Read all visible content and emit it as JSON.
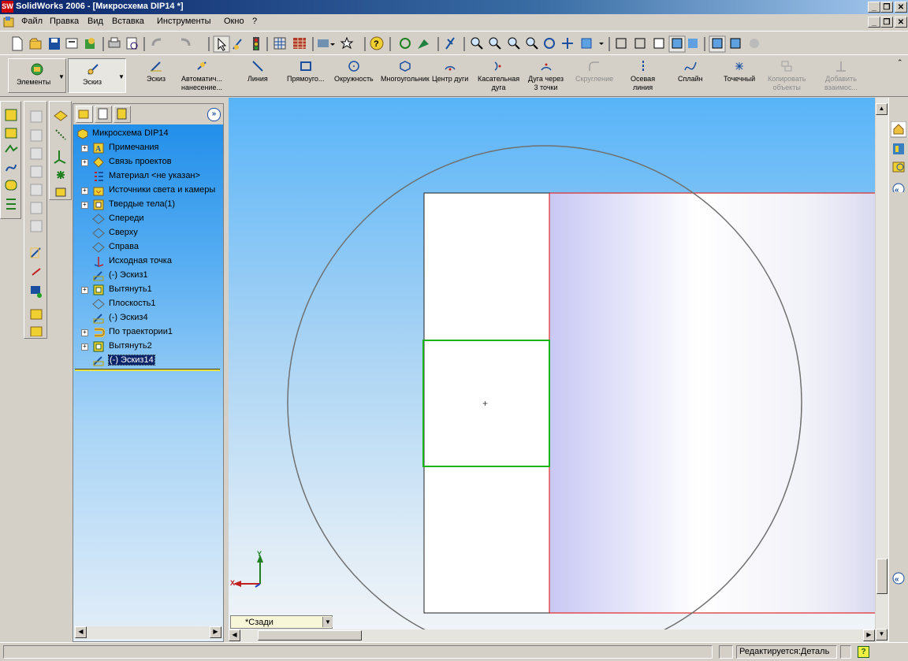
{
  "window": {
    "title": "SolidWorks 2006 - [Микросхема DIP14 *]",
    "app_icon": "SW",
    "min": "_",
    "restore": "❐",
    "close": "✕"
  },
  "menu": {
    "items": [
      "Файл",
      "Правка",
      "Вид",
      "Вставка",
      "Инструменты",
      "Окно",
      "?"
    ]
  },
  "command_manager": {
    "features_label": "Элементы",
    "sketch_tab_label": "Эскиз",
    "commands": [
      {
        "label_1": "Эскиз",
        "label_2": "",
        "icon": "sketch-icon",
        "enabled": true
      },
      {
        "label_1": "Автоматич...",
        "label_2": "нанесение...",
        "icon": "smart-dimension-icon",
        "enabled": true
      },
      {
        "label_1": "Линия",
        "label_2": "",
        "icon": "line-icon",
        "enabled": true
      },
      {
        "label_1": "Прямоуго...",
        "label_2": "",
        "icon": "rectangle-icon",
        "enabled": true
      },
      {
        "label_1": "Окружность",
        "label_2": "",
        "icon": "circle-icon",
        "enabled": true
      },
      {
        "label_1": "Многоугольник",
        "label_2": "",
        "icon": "polygon-icon",
        "enabled": true
      },
      {
        "label_1": "Центр дуги",
        "label_2": "",
        "icon": "centerpoint-arc-icon",
        "enabled": true
      },
      {
        "label_1": "Касательная",
        "label_2": "дуга",
        "icon": "tangent-arc-icon",
        "enabled": true
      },
      {
        "label_1": "Дуга через",
        "label_2": "3 точки",
        "icon": "3point-arc-icon",
        "enabled": true
      },
      {
        "label_1": "Скругление",
        "label_2": "",
        "icon": "fillet-icon",
        "enabled": false
      },
      {
        "label_1": "Осевая",
        "label_2": "линия",
        "icon": "centerline-icon",
        "enabled": true
      },
      {
        "label_1": "Сплайн",
        "label_2": "",
        "icon": "spline-icon",
        "enabled": true
      },
      {
        "label_1": "Точечный",
        "label_2": "",
        "icon": "point-icon",
        "enabled": true
      },
      {
        "label_1": "Копировать",
        "label_2": "объекты",
        "icon": "copy-entities-icon",
        "enabled": false
      },
      {
        "label_1": "Добавить",
        "label_2": "взаимос...",
        "icon": "add-relation-icon",
        "enabled": false
      }
    ]
  },
  "feature_tree": {
    "collapse_glyph": "»",
    "root": "Микросхема DIP14",
    "items": [
      {
        "label": "Примечания",
        "expandable": true,
        "icon": "annotations-icon"
      },
      {
        "label": "Связь проектов",
        "expandable": true,
        "icon": "design-binder-icon"
      },
      {
        "label": "Материал <не указан>",
        "expandable": false,
        "icon": "material-icon"
      },
      {
        "label": "Источники света и камеры",
        "expandable": true,
        "icon": "lights-icon"
      },
      {
        "label": "Твердые тела(1)",
        "expandable": true,
        "icon": "solid-bodies-icon"
      },
      {
        "label": "Спереди",
        "expandable": false,
        "icon": "plane-icon"
      },
      {
        "label": "Сверху",
        "expandable": false,
        "icon": "plane-icon"
      },
      {
        "label": "Справа",
        "expandable": false,
        "icon": "plane-icon"
      },
      {
        "label": "Исходная точка",
        "expandable": false,
        "icon": "origin-icon"
      },
      {
        "label": "(-) Эскиз1",
        "expandable": false,
        "icon": "sketch-icon"
      },
      {
        "label": "Вытянуть1",
        "expandable": true,
        "icon": "extrude-icon"
      },
      {
        "label": "Плоскость1",
        "expandable": false,
        "icon": "plane-icon"
      },
      {
        "label": "(-) Эскиз4",
        "expandable": false,
        "icon": "sketch-icon"
      },
      {
        "label": "По траектории1",
        "expandable": true,
        "icon": "sweep-icon"
      },
      {
        "label": "Вытянуть2",
        "expandable": true,
        "icon": "extrude-icon"
      },
      {
        "label": "(-) Эскиз14",
        "expandable": false,
        "icon": "sketch-icon",
        "selected": true
      }
    ]
  },
  "viewport": {
    "view_name": "*Сзади",
    "triad_x": "X",
    "triad_y": "Y",
    "origin_mark": "+"
  },
  "statusbar": {
    "mode": "Редактируется:Деталь",
    "help": "?"
  },
  "colors": {
    "sketch_green": "#18b418",
    "edge_red": "#e03030",
    "selection": "#0a246a"
  }
}
